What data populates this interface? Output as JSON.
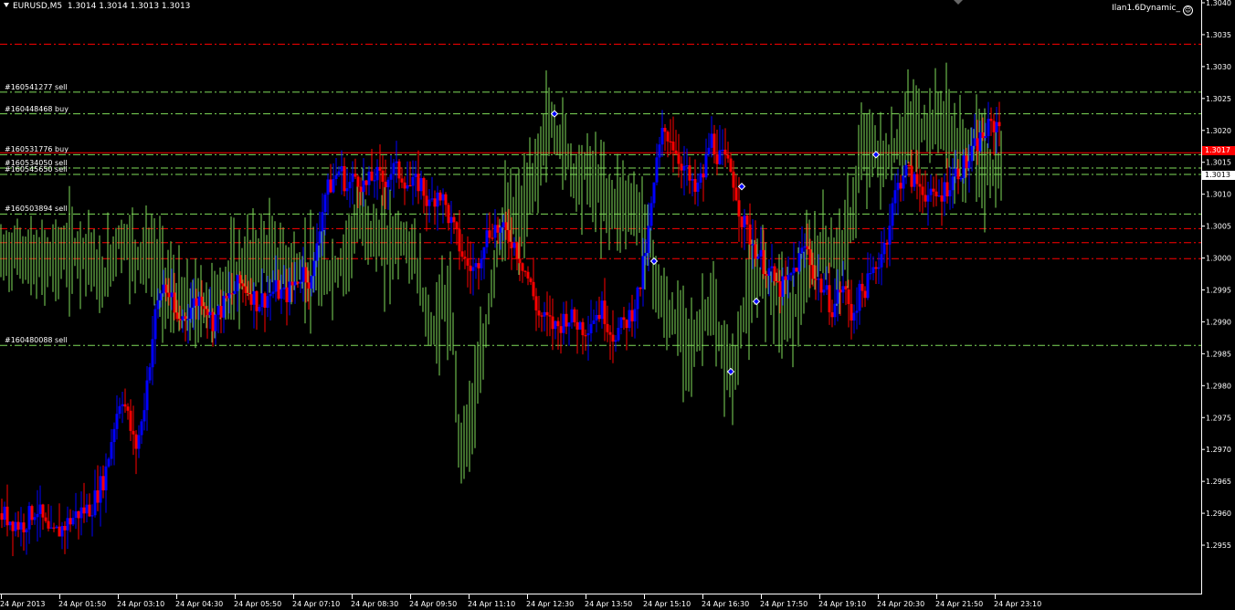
{
  "header": {
    "symbol": "EURUSD,M5",
    "ohlc": "1.3014 1.3014 1.3013 1.3013",
    "ea_name": "Ilan1.6Dynamic_",
    "ea_icon": "smiley-icon"
  },
  "colors": {
    "background": "#000000",
    "bull_candle": "#0000ff",
    "bear_candle": "#ff0000",
    "green_bars": "#7fdc5a",
    "sell_level": "#ff0000",
    "buy_level": "#7fdc5a",
    "grid_text": "#ffffff"
  },
  "price_axis": {
    "labels": [
      "1.3040",
      "1.3035",
      "1.3030",
      "1.3025",
      "1.3020",
      "1.3015",
      "1.3010",
      "1.3005",
      "1.3000",
      "1.2995",
      "1.2990",
      "1.2985",
      "1.2980",
      "1.2975",
      "1.2970",
      "1.2965",
      "1.2960",
      "1.2955"
    ],
    "bid_price": "1.3017",
    "ask_price": "1.3013"
  },
  "time_axis": {
    "labels": [
      "24 Apr 2013",
      "24 Apr 01:50",
      "24 Apr 03:10",
      "24 Apr 04:30",
      "24 Apr 05:50",
      "24 Apr 07:10",
      "24 Apr 08:30",
      "24 Apr 09:50",
      "24 Apr 11:10",
      "24 Apr 12:30",
      "24 Apr 13:50",
      "24 Apr 15:10",
      "24 Apr 16:30",
      "24 Apr 17:50",
      "24 Apr 19:10",
      "24 Apr 20:30",
      "24 Apr 21:50",
      "24 Apr 23:10"
    ]
  },
  "orders": [
    {
      "label": "#160541277 sell",
      "price": 1.3026
    },
    {
      "label": "#160448468 buy",
      "price": 1.30226
    },
    {
      "label": "#160531776 buy",
      "price": 1.30162
    },
    {
      "label": "#160534050 sell",
      "price": 1.30141
    },
    {
      "label": "#160545650 sell",
      "price": 1.30131
    },
    {
      "label": "#160503894 sell",
      "price": 1.30069
    },
    {
      "label": "#160480088 sell",
      "price": 1.29863
    }
  ],
  "levels": {
    "red_dashed": [
      1.30335,
      1.30046,
      1.30024,
      1.29999
    ],
    "green_dashed": [
      1.3026,
      1.30226,
      1.30162,
      1.30141,
      1.30131,
      1.30069,
      1.29863
    ],
    "red_solid": [
      1.30165
    ]
  },
  "chart_data": {
    "type": "line",
    "series": [
      {
        "values": [
          [
            0,
            1.296
          ],
          [
            24,
            1.2958
          ],
          [
            40,
            1.2961
          ],
          [
            55,
            1.2956
          ],
          [
            70,
            1.2958
          ],
          [
            85,
            1.296
          ],
          [
            100,
            1.2961
          ],
          [
            115,
            1.2966
          ],
          [
            125,
            1.2974
          ],
          [
            133,
            1.2979
          ],
          [
            140,
            1.2975
          ],
          [
            148,
            1.297
          ],
          [
            155,
            1.2974
          ],
          [
            163,
            1.2983
          ],
          [
            170,
            1.2991
          ],
          [
            178,
            1.2996
          ],
          [
            186,
            1.2994
          ],
          [
            193,
            1.299
          ],
          [
            202,
            1.2991
          ],
          [
            212,
            1.2993
          ],
          [
            222,
            1.2994
          ],
          [
            232,
            1.299
          ],
          [
            242,
            1.2992
          ],
          [
            252,
            1.2994
          ],
          [
            262,
            1.2996
          ],
          [
            272,
            1.2995
          ],
          [
            282,
            1.2993
          ],
          [
            292,
            1.2994
          ],
          [
            302,
            1.2995
          ],
          [
            312,
            1.2994
          ],
          [
            322,
            1.2996
          ],
          [
            332,
            1.2998
          ],
          [
            342,
            1.2996
          ],
          [
            348,
            1.3004
          ],
          [
            356,
            1.301
          ],
          [
            364,
            1.3012
          ],
          [
            372,
            1.3014
          ],
          [
            380,
            1.3011
          ],
          [
            390,
            1.3013
          ],
          [
            400,
            1.3011
          ],
          [
            410,
            1.3013
          ],
          [
            420,
            1.3012
          ],
          [
            430,
            1.3014
          ],
          [
            440,
            1.3013
          ],
          [
            450,
            1.3011
          ],
          [
            460,
            1.3012
          ],
          [
            470,
            1.3008
          ],
          [
            480,
            1.3011
          ],
          [
            490,
            1.3007
          ],
          [
            500,
            1.3003
          ],
          [
            510,
            1.2999
          ],
          [
            520,
            1.2998
          ],
          [
            530,
            1.3003
          ],
          [
            540,
            1.3005
          ],
          [
            550,
            1.3004
          ],
          [
            560,
            1.3003
          ],
          [
            570,
            1.3
          ],
          [
            580,
            1.2996
          ],
          [
            590,
            1.2991
          ],
          [
            600,
            1.299
          ],
          [
            610,
            1.2989
          ],
          [
            620,
            1.2991
          ],
          [
            630,
            1.299
          ],
          [
            640,
            1.2989
          ],
          [
            650,
            1.2991
          ],
          [
            660,
            1.2992
          ],
          [
            670,
            1.2988
          ],
          [
            680,
            1.2989
          ],
          [
            690,
            1.2991
          ],
          [
            700,
            1.2995
          ],
          [
            710,
            1.3004
          ],
          [
            718,
            1.3014
          ],
          [
            726,
            1.302
          ],
          [
            734,
            1.3019
          ],
          [
            742,
            1.3016
          ],
          [
            750,
            1.3014
          ],
          [
            760,
            1.301
          ],
          [
            770,
            1.3013
          ],
          [
            778,
            1.3019
          ],
          [
            786,
            1.3016
          ],
          [
            794,
            1.3015
          ],
          [
            802,
            1.3013
          ],
          [
            812,
            1.3006
          ],
          [
            822,
            1.3003
          ],
          [
            832,
            1.3
          ],
          [
            842,
            1.2998
          ],
          [
            852,
            1.2995
          ],
          [
            862,
            1.2996
          ],
          [
            872,
            1.2999
          ],
          [
            882,
            1.3002
          ],
          [
            892,
            1.2997
          ],
          [
            902,
            1.2995
          ],
          [
            912,
            1.2992
          ],
          [
            922,
            1.2996
          ],
          [
            932,
            1.2991
          ],
          [
            940,
            1.2994
          ],
          [
            950,
            1.2996
          ],
          [
            960,
            1.2999
          ],
          [
            970,
            1.3003
          ],
          [
            980,
            1.301
          ],
          [
            990,
            1.3014
          ],
          [
            1000,
            1.3012
          ],
          [
            1010,
            1.3011
          ],
          [
            1020,
            1.3009
          ],
          [
            1030,
            1.301
          ],
          [
            1040,
            1.3012
          ],
          [
            1050,
            1.3014
          ],
          [
            1060,
            1.3015
          ],
          [
            1070,
            1.3018
          ],
          [
            1080,
            1.302
          ],
          [
            1090,
            1.3021
          ],
          [
            1096,
            1.3021
          ]
        ]
      },
      {
        "values": [
          [
            0,
            1.3
          ],
          [
            20,
            1.3001
          ],
          [
            40,
            1.2999
          ],
          [
            60,
            1.3
          ],
          [
            80,
            1.3001
          ],
          [
            100,
            1.3001
          ],
          [
            110,
            1.2995
          ],
          [
            120,
            1.2999
          ],
          [
            130,
            1.3003
          ],
          [
            140,
            1.3002
          ],
          [
            150,
            1.3
          ],
          [
            160,
            1.3001
          ],
          [
            170,
            1.2999
          ],
          [
            180,
            1.2996
          ],
          [
            190,
            1.2994
          ],
          [
            200,
            1.2993
          ],
          [
            210,
            1.2992
          ],
          [
            230,
            1.2993
          ],
          [
            250,
            1.2996
          ],
          [
            270,
            1.2999
          ],
          [
            290,
            1.3001
          ],
          [
            310,
            1.2999
          ],
          [
            330,
            1.2998
          ],
          [
            350,
            1.2997
          ],
          [
            370,
            1.2998
          ],
          [
            385,
            1.3003
          ],
          [
            395,
            1.3007
          ],
          [
            405,
            1.3004
          ],
          [
            420,
            1.3002
          ],
          [
            440,
            1.3003
          ],
          [
            455,
            1.3
          ],
          [
            465,
            1.2992
          ],
          [
            475,
            1.2988
          ],
          [
            485,
            1.2994
          ],
          [
            495,
            1.299
          ],
          [
            503,
            1.297
          ],
          [
            510,
            1.2972
          ],
          [
            520,
            1.2978
          ],
          [
            530,
            1.2986
          ],
          [
            540,
            1.2998
          ],
          [
            550,
            1.3005
          ],
          [
            560,
            1.3007
          ],
          [
            570,
            1.3006
          ],
          [
            580,
            1.301
          ],
          [
            590,
            1.3015
          ],
          [
            600,
            1.3022
          ],
          [
            610,
            1.3019
          ],
          [
            620,
            1.3017
          ],
          [
            630,
            1.3012
          ],
          [
            640,
            1.3014
          ],
          [
            650,
            1.3012
          ],
          [
            660,
            1.301
          ],
          [
            670,
            1.3008
          ],
          [
            680,
            1.3009
          ],
          [
            690,
            1.3008
          ],
          [
            700,
            1.3007
          ],
          [
            710,
            1.3003
          ],
          [
            720,
            1.2995
          ],
          [
            730,
            1.2991
          ],
          [
            740,
            1.299
          ],
          [
            750,
            1.2988
          ],
          [
            760,
            1.2986
          ],
          [
            770,
            1.2991
          ],
          [
            780,
            1.2992
          ],
          [
            790,
            1.2985
          ],
          [
            800,
            1.2982
          ],
          [
            806,
            1.2983
          ],
          [
            815,
            1.2993
          ],
          [
            825,
            1.2995
          ],
          [
            835,
            1.2998
          ],
          [
            845,
            1.2995
          ],
          [
            855,
            1.2994
          ],
          [
            865,
            1.2991
          ],
          [
            875,
            1.2994
          ],
          [
            885,
            1.2998
          ],
          [
            895,
            1.3001
          ],
          [
            905,
            1.3002
          ],
          [
            915,
            1.3
          ],
          [
            925,
            1.3002
          ],
          [
            935,
            1.3008
          ],
          [
            942,
            1.3016
          ],
          [
            950,
            1.3018
          ],
          [
            960,
            1.3016
          ],
          [
            970,
            1.3015
          ],
          [
            980,
            1.3017
          ],
          [
            990,
            1.3019
          ],
          [
            1000,
            1.3021
          ],
          [
            1010,
            1.302
          ],
          [
            1020,
            1.3021
          ],
          [
            1030,
            1.3022
          ],
          [
            1038,
            1.3021
          ],
          [
            1046,
            1.3017
          ],
          [
            1056,
            1.3016
          ],
          [
            1066,
            1.3018
          ],
          [
            1076,
            1.3015
          ],
          [
            1086,
            1.3013
          ],
          [
            1096,
            1.3013
          ]
        ]
      }
    ],
    "arrows": [
      [
        607,
        1.30226
      ],
      [
        716,
        1.29995
      ],
      [
        812,
        1.30112
      ],
      [
        828,
        1.29932
      ],
      [
        800,
        1.29822
      ],
      [
        959,
        1.30162
      ]
    ],
    "ylim": [
      1.2952,
      1.304
    ],
    "grid": false
  }
}
